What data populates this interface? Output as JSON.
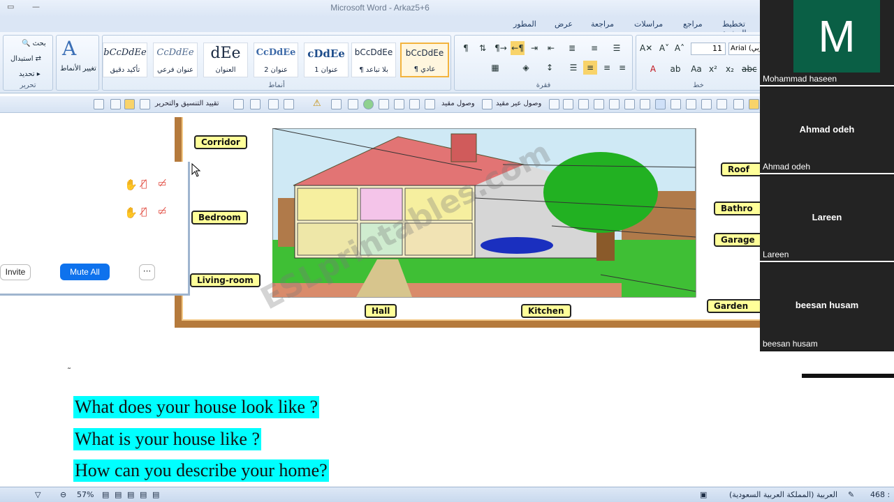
{
  "window": {
    "title": "Microsoft Word - Arkaz5+6"
  },
  "ribbon_tabs": [
    "المطور",
    "عرض",
    "مراجعة",
    "مراسلات",
    "مراجع",
    "تخطيط الصفحة"
  ],
  "ribbon": {
    "editing": {
      "label": "تحرير",
      "find": "بحث",
      "replace": "استبدال",
      "select": "تحديد"
    },
    "change_styles": "تغيير الأنماط",
    "styles_label": "أنماط",
    "styles": [
      {
        "sample": "bCcDdEe",
        "name": "تأكيد دقيق"
      },
      {
        "sample": "CcDdEe",
        "name": "عنوان فرعي"
      },
      {
        "sample": "dEe",
        "name": "العنوان"
      },
      {
        "sample": "CcDdEe",
        "name": "عنوان 2"
      },
      {
        "sample": "cDdEe",
        "name": "عنوان 1"
      },
      {
        "sample": "bCcDdEe",
        "name": "¶ بلا تباعد"
      },
      {
        "sample": "bCcDdEe",
        "name": "¶ عادي"
      }
    ],
    "paragraph_label": "فقرة",
    "font_label": "خط",
    "font_size": "11",
    "font_name": "Arial (عربي"
  },
  "toolbar2": {
    "restrict": "تقييد التنسيق والتحرير",
    "unlinked": "وصول عير مقيد",
    "linked": "وصول مقيد"
  },
  "worksheet": {
    "labels": {
      "corridor": "Corridor",
      "bedroom": "Bedroom",
      "living_room": "Living-room",
      "hall": "Hall",
      "kitchen": "Kitchen",
      "roof": "Roof",
      "bathroom": "Bathro",
      "garage": "Garage",
      "garden": "Garden"
    },
    "watermark": "ESLprintables.com"
  },
  "participants_panel": {
    "invite": "Invite",
    "mute_all": "Mute All",
    "more": "···"
  },
  "questions": [
    "What does your house look like ?",
    "What is your house like ?",
    "How can you describe your home?"
  ],
  "status_bar": {
    "zoom": "57%",
    "language": "العربية (المملكة العربية السعودية)",
    "words": "468 :"
  },
  "participants": [
    {
      "name": "Mohammad haseen",
      "initial": "M"
    },
    {
      "name": "Ahmad odeh"
    },
    {
      "name": "Lareen"
    },
    {
      "name": "beesan husam"
    }
  ],
  "colors": {
    "highlight": "#00ffff",
    "zoom_blue": "#0e72ed",
    "avatar_green": "#0a5f45"
  }
}
